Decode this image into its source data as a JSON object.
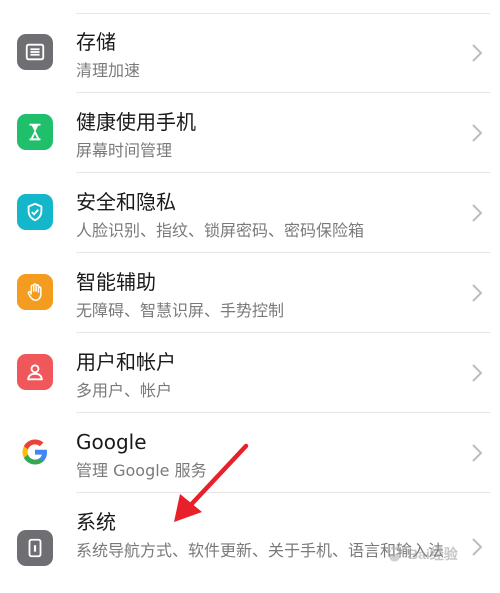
{
  "items": [
    {
      "id": "storage",
      "title": "存储",
      "subtitle": "清理加速",
      "icon": "storage-icon",
      "icon_bg": "#6e6e73"
    },
    {
      "id": "digital-balance",
      "title": "健康使用手机",
      "subtitle": "屏幕时间管理",
      "icon": "hourglass-icon",
      "icon_bg": "#1fbf6b"
    },
    {
      "id": "security-privacy",
      "title": "安全和隐私",
      "subtitle": "人脸识别、指纹、锁屏密码、密码保险箱",
      "icon": "shield-icon",
      "icon_bg": "#14b6c9"
    },
    {
      "id": "accessibility",
      "title": "智能辅助",
      "subtitle": "无障碍、智慧识屏、手势控制",
      "icon": "hand-icon",
      "icon_bg": "#f39c1f"
    },
    {
      "id": "users-accounts",
      "title": "用户和帐户",
      "subtitle": "多用户、帐户",
      "icon": "user-icon",
      "icon_bg": "#f0575a"
    },
    {
      "id": "google",
      "title": "Google",
      "subtitle": "管理 Google 服务",
      "icon": "google-icon",
      "icon_bg": "#ffffff"
    },
    {
      "id": "system",
      "title": "系统",
      "subtitle": "系统导航方式、软件更新、关于手机、语言和输入法",
      "icon": "phone-icon",
      "icon_bg": "#6e6e73"
    }
  ],
  "colors": {
    "title": "#1a1a1a",
    "subtitle": "#7a7a7a",
    "divider": "#e6e6e6",
    "annotation_arrow": "#e8202a"
  },
  "watermark": {
    "text": "Bai经验",
    "icon": "baidu-paw-icon"
  }
}
